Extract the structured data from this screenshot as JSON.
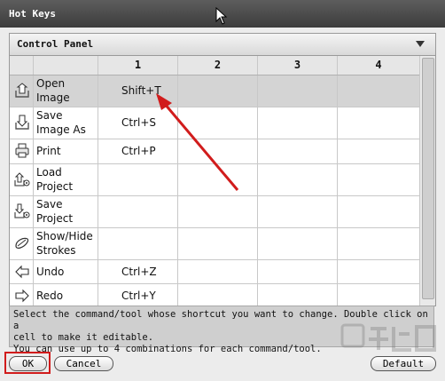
{
  "window": {
    "title": "Hot Keys"
  },
  "panel": {
    "title": "Control Panel"
  },
  "columns": [
    "",
    "",
    "1",
    "2",
    "3",
    "4"
  ],
  "rows": [
    {
      "icon": "open-image-icon",
      "name": "Open Image",
      "key1": "Shift+T",
      "key2": "",
      "key3": "",
      "key4": "",
      "selected": true
    },
    {
      "icon": "save-image-icon",
      "name": "Save Image As",
      "key1": "Ctrl+S",
      "key2": "",
      "key3": "",
      "key4": ""
    },
    {
      "icon": "print-icon",
      "name": "Print",
      "key1": "Ctrl+P",
      "key2": "",
      "key3": "",
      "key4": ""
    },
    {
      "icon": "load-project-icon",
      "name": "Load Project",
      "key1": "",
      "key2": "",
      "key3": "",
      "key4": ""
    },
    {
      "icon": "save-project-icon",
      "name": "Save Project",
      "key1": "",
      "key2": "",
      "key3": "",
      "key4": ""
    },
    {
      "icon": "show-hide-strokes-icon",
      "name": "Show/Hide Strokes",
      "key1": "",
      "key2": "",
      "key3": "",
      "key4": ""
    },
    {
      "icon": "undo-icon",
      "name": "Undo",
      "key1": "Ctrl+Z",
      "key2": "",
      "key3": "",
      "key4": ""
    },
    {
      "icon": "redo-icon",
      "name": "Redo",
      "key1": "Ctrl+Y",
      "key2": "",
      "key3": "",
      "key4": ""
    }
  ],
  "info": {
    "line1": "Select the command/tool whose shortcut you want to change. Double click on a",
    "line2": "cell to make it editable.",
    "line3": "You can use up to 4 combinations for each command/tool."
  },
  "buttons": {
    "ok": "OK",
    "cancel": "Cancel",
    "default": "Default"
  },
  "colors": {
    "titlebar": "#4a4a4a",
    "selected_row": "#d4d4d4",
    "highlight": "#d11c1c"
  }
}
